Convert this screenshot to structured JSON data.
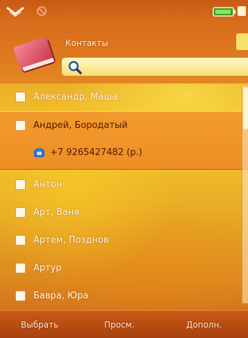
{
  "header": {
    "title": "Контакты"
  },
  "search": {
    "value": ""
  },
  "contacts": [
    {
      "name": "Александр, Маша"
    },
    {
      "name": "Андрей, Бородатый",
      "phone": "+7 9265427482 (р.)"
    },
    {
      "name": "Антон"
    },
    {
      "name": "Арт, Ваня"
    },
    {
      "name": "Артем, Позднов"
    },
    {
      "name": "Артур"
    },
    {
      "name": "Бавра, Юра"
    }
  ],
  "softkeys": {
    "left": "Выбрать",
    "center": "Просм.",
    "right": "Дополн."
  },
  "colors": {
    "highlight": "#ee8e28",
    "background_top": "#d5731b",
    "background_mid": "#f3c52e",
    "softkey_bar": "#a9410f"
  },
  "icons": {
    "status_left": "signal-icon",
    "status_profile": "profile-icon",
    "status_right": "battery-icon",
    "header": "address-book-icon",
    "search": "magnifier-icon",
    "phone": "phone-icon"
  }
}
